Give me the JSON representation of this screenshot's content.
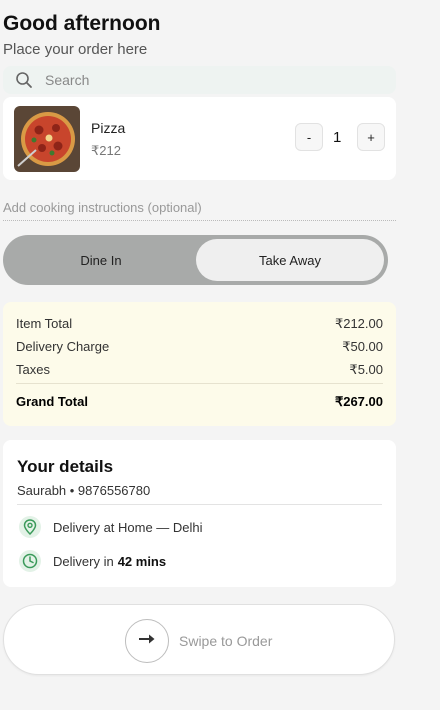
{
  "header": {
    "greeting": "Good afternoon",
    "subtitle": "Place your order here"
  },
  "search": {
    "placeholder": "Search",
    "icon": "search-icon"
  },
  "item": {
    "name": "Pizza",
    "price": "₹212",
    "quantity": "1",
    "decrement_label": "-",
    "increment_label": "+"
  },
  "instructions": {
    "placeholder": "Add cooking instructions (optional)"
  },
  "order_type": {
    "options": [
      "Dine In",
      "Take Away"
    ],
    "selected": "Take Away"
  },
  "bill": {
    "rows": [
      {
        "label": "Item Total",
        "value": "₹212.00"
      },
      {
        "label": "Delivery Charge",
        "value": "₹50.00"
      },
      {
        "label": "Taxes",
        "value": "₹5.00"
      }
    ],
    "grand_total_label": "Grand Total",
    "grand_total_value": "₹267.00"
  },
  "details": {
    "heading": "Your details",
    "contact": "Saurabh • 9876556780",
    "location_text": "Delivery at Home — Delhi",
    "time_prefix": "Delivery in",
    "time_value": "42 mins"
  },
  "swipe": {
    "label": "Swipe to Order",
    "icon": "arrow-right-icon"
  },
  "colors": {
    "accent_green": "#3a9a5a",
    "bill_bg": "#fdfbea",
    "toggle_bg": "#a8aaa9"
  }
}
